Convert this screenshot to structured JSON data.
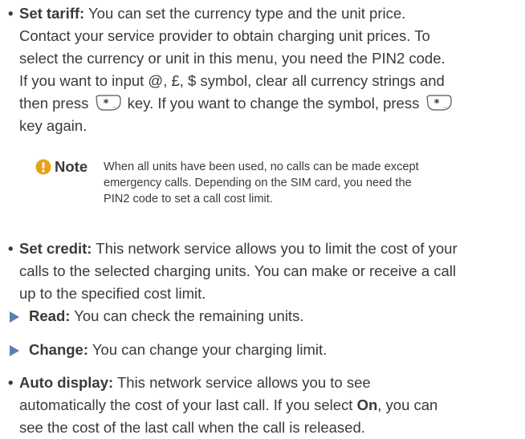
{
  "set_tariff": {
    "title": "Set tariff:",
    "line1": "You can set the currency type and the unit price.",
    "line2": "Contact your service provider to obtain charging unit prices. To",
    "line3": "select the currency or unit in this menu, you need the PIN2 code.",
    "line4": "If you want to input @, £, $ symbol, clear all currency strings and",
    "line5a": "then press",
    "line5b": "key. If you want to change the symbol, press",
    "line6": "key again."
  },
  "note": {
    "label": "Note",
    "line1": "When all units have been used, no calls can be made except",
    "line2": "emergency calls. Depending on the SIM card, you need the",
    "line3": "PIN2 code to set a call cost limit."
  },
  "set_credit": {
    "title": "Set credit:",
    "line1": "This network service allows you to limit the cost of your",
    "line2": "calls to the selected charging units. You can make or receive a call",
    "line3": "up to the specified cost limit."
  },
  "read": {
    "title": "Read:",
    "text": "You can check the remaining units."
  },
  "change": {
    "title": "Change:",
    "text": "You can change your charging limit."
  },
  "auto_display": {
    "title": "Auto display:",
    "line1": "This network service allows you to see",
    "line2a": "automatically the cost of your last call. If you select",
    "line2b": "On",
    "line2c": ", you can",
    "line3": "see the cost of the last call when the call is released."
  },
  "bullet_char": "•",
  "colors": {
    "text": "#3a3a3a",
    "arrow": "#5a7fb0",
    "note_icon": "#e8a21a"
  },
  "icons": {
    "star_key": "star-key-icon",
    "note": "note-icon",
    "arrow": "arrow-icon"
  }
}
